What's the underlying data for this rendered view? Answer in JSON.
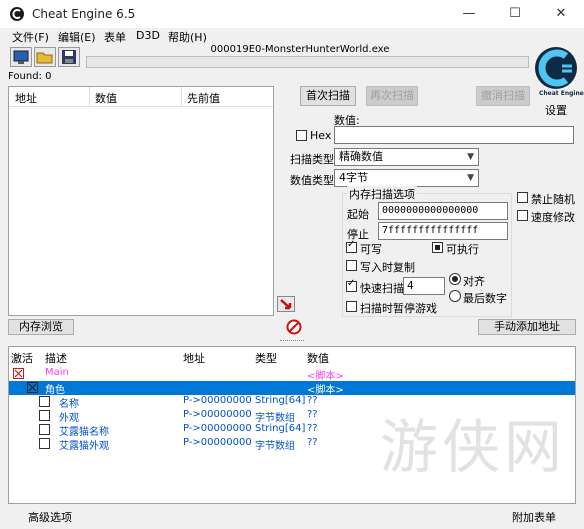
{
  "window": {
    "title": "Cheat Engine 6.5",
    "min": "—",
    "max": "☐",
    "close": "✕"
  },
  "menu": [
    "文件(F)",
    "编辑(E)",
    "表单",
    "D3D",
    "帮助(H)"
  ],
  "process": "000019E0-MonsterHunterWorld.exe",
  "found": "Found: 0",
  "settings_label": "设置",
  "logo_caption": "Cheat Engine",
  "results": {
    "columns": [
      "地址",
      "数值",
      "先前值"
    ]
  },
  "scan": {
    "first_scan": "首次扫描",
    "next_scan": "再次扫描",
    "undo_scan": "撤消扫描",
    "value_label": "数值:",
    "hex_label": "Hex",
    "scan_type_label": "扫描类型",
    "scan_type_value": "精确数值",
    "value_type_label": "数值类型",
    "value_type_value": "4字节"
  },
  "memory": {
    "title": "内存扫描选项",
    "start_label": "起始",
    "start_value": "0000000000000000",
    "stop_label": "停止",
    "stop_value": "7fffffffffffffff",
    "writable": "可写",
    "executable": "可执行",
    "copy_on_write": "写入时复制",
    "fast_scan": "快速扫描",
    "fast_scan_value": "4",
    "align": "对齐",
    "last_digits": "最后数字",
    "pause_game": "扫描时暂停游戏"
  },
  "options": {
    "no_random": "禁止随机",
    "speedhack": "速度修改"
  },
  "buttons": {
    "memory_view": "内存浏览",
    "add_address": "手动添加地址"
  },
  "table": {
    "columns": [
      "激活",
      "描述",
      "地址",
      "类型",
      "数值"
    ],
    "rows": [
      {
        "desc": "Main",
        "addr": "",
        "type": "",
        "value": "<脚本>",
        "desc_color": "#ff40ff",
        "value_color": "#ff40ff"
      },
      {
        "desc": "角色",
        "addr": "",
        "type": "",
        "value": "<脚本>",
        "desc_color": "#ffffff",
        "value_color": "#ffffff"
      },
      {
        "desc": "名称",
        "addr": "P->00000000",
        "type": "String[64]",
        "value": "??"
      },
      {
        "desc": "外观",
        "addr": "P->00000000",
        "type": "字节数组",
        "value": "??"
      },
      {
        "desc": "艾露猫名称",
        "addr": "P->00000000",
        "type": "String[64]",
        "value": "??"
      },
      {
        "desc": "艾露猫外观",
        "addr": "P->00000000",
        "type": "字节数组",
        "value": "??"
      }
    ]
  },
  "footer": {
    "advanced": "高级选项",
    "table_extras": "附加表单"
  },
  "watermark": "游侠网",
  "colors": {
    "accent": "#0078d7",
    "link_blue": "#0050d0",
    "script_pink": "#ff40ff"
  }
}
